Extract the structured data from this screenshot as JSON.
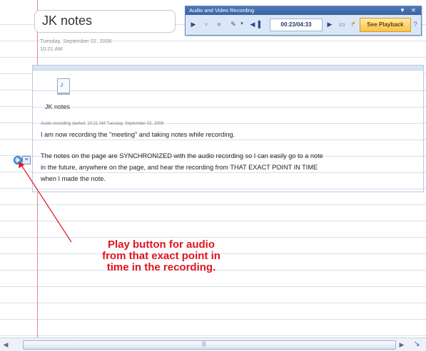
{
  "page": {
    "title": "JK notes",
    "date": "Tuesday, September 02, 2008",
    "time": "10:21 AM"
  },
  "av_toolbar": {
    "title": "Audio and Video Recording",
    "dropdown_glyph": "▼",
    "close_glyph": "✕",
    "time_display": "00:23/04:33",
    "see_playback_label": "See Playback"
  },
  "note": {
    "file_label": "JK notes",
    "recording_started": "Audio recording started: 10:21 AM Tuesday, September 02, 2008",
    "lines": [
      "I am now recording the \"meeting\" and taking notes while recording.",
      "The notes on the page are SYNCHRONIZED with the audio recording so I can easily go to a note",
      "in the future, anywhere on the page, and hear the recording from THAT EXACT POINT IN TIME",
      "when I made the note."
    ]
  },
  "annotation": {
    "lines": [
      "Play button for audio",
      "from that exact point in",
      "time in the recording."
    ]
  },
  "icons": {
    "play": "play-icon",
    "pause": "pause-icon",
    "stop": "stop-icon",
    "file": "audio-file-icon"
  },
  "colors": {
    "annotation": "#e0141e",
    "margin_line": "#e08a8a",
    "toolbar_title": "#4e78b6",
    "see_playback": "#f8c44a"
  }
}
